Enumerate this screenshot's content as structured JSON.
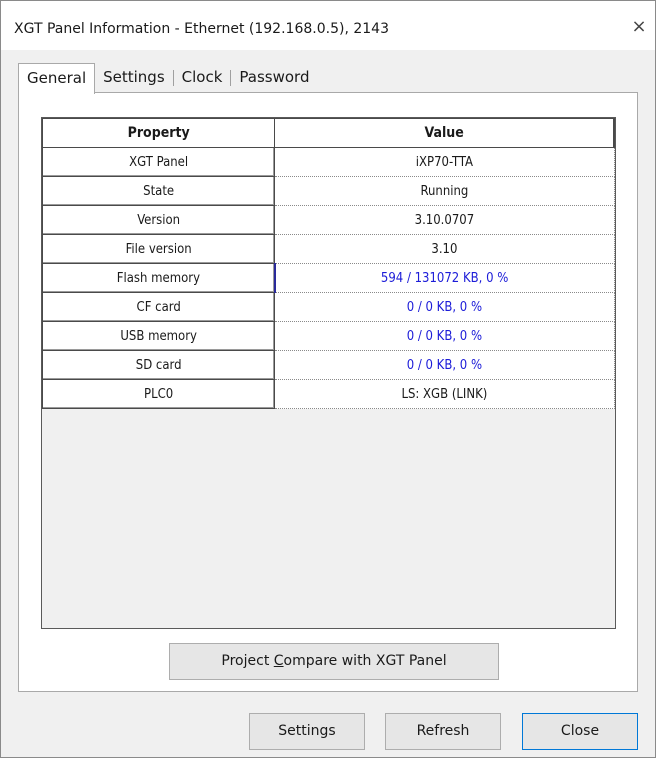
{
  "window": {
    "title": "XGT Panel Information - Ethernet (192.168.0.5), 2143",
    "close_glyph": "×"
  },
  "tabs": [
    {
      "label": "General",
      "active": true
    },
    {
      "label": "Settings",
      "active": false
    },
    {
      "label": "Clock",
      "active": false
    },
    {
      "label": "Password",
      "active": false
    }
  ],
  "grid": {
    "columns": [
      "Property",
      "Value"
    ],
    "rows": [
      {
        "property": "XGT Panel",
        "value": "iXP70-TTA",
        "color": "default"
      },
      {
        "property": "State",
        "value": "Running",
        "color": "default"
      },
      {
        "property": "Version",
        "value": "3.10.0707",
        "color": "default"
      },
      {
        "property": "File version",
        "value": "3.10",
        "color": "default"
      },
      {
        "property": "Flash memory",
        "value": "594 / 131072 KB, 0 %",
        "color": "blue"
      },
      {
        "property": "CF card",
        "value": "0 / 0 KB, 0 %",
        "color": "blue"
      },
      {
        "property": "USB memory",
        "value": "0 / 0 KB, 0 %",
        "color": "blue"
      },
      {
        "property": "SD card",
        "value": "0 / 0 KB, 0 %",
        "color": "blue"
      },
      {
        "property": "PLC0",
        "value": "LS: XGB (LINK)",
        "color": "default"
      }
    ]
  },
  "compare_button": {
    "prefix": "Project ",
    "mnemonic": "C",
    "suffix": "ompare with XGT Panel"
  },
  "footer": {
    "settings_label": "Settings",
    "refresh_label": "Refresh",
    "close_label": "Close"
  },
  "colors": {
    "link_blue": "#1c1cd8",
    "focus_border": "#0078d7"
  }
}
